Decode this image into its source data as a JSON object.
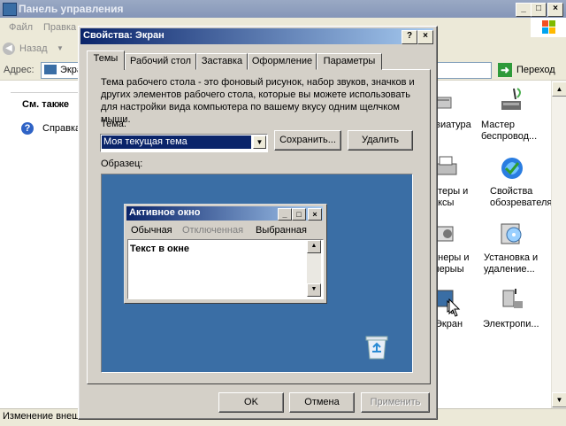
{
  "background_window": {
    "title": "Панель управления",
    "menu": [
      "Файл",
      "Правка"
    ],
    "toolbar": {
      "back_label": "Назад"
    },
    "address": {
      "label": "Адрес:",
      "value": "Экран",
      "go_label": "Переход"
    },
    "see_also": {
      "title": "См. также",
      "items": [
        "Справка"
      ]
    },
    "icons": [
      {
        "name": "keyboard",
        "label": "авиатура"
      },
      {
        "name": "wireless",
        "label": "Мастер\nбеспровод..."
      },
      {
        "name": "printers",
        "label": "нтеры и\nаксы"
      },
      {
        "name": "browser",
        "label": "Свойства\nобозревателя"
      },
      {
        "name": "scanners",
        "label": "анеры и\nмеры"
      },
      {
        "name": "addremove",
        "label": "Установка и\nудаление..."
      },
      {
        "name": "display",
        "label": "Экран"
      },
      {
        "name": "power",
        "label": "Электропи..."
      }
    ],
    "status": "Изменение внешн"
  },
  "dialog": {
    "title": "Свойства: Экран",
    "tabs": [
      "Темы",
      "Рабочий стол",
      "Заставка",
      "Оформление",
      "Параметры"
    ],
    "active_tab": "Темы",
    "description": "Тема рабочего стола - это фоновый рисунок, набор звуков, значков и других элементов рабочего стола, которые вы можете использовать для настройки вида компьютера по вашему вкусу одним щелчком мыши.",
    "theme_label": "Тема:",
    "theme_value": "Моя текущая тема",
    "save_label": "Сохранить...",
    "delete_label": "Удалить",
    "preview_label": "Образец:",
    "preview_window": {
      "title": "Активное окно",
      "menu_normal": "Обычная",
      "menu_disabled": "Отключенная",
      "menu_selected": "Выбранная",
      "text": "Текст в окне"
    },
    "ok_label": "OK",
    "cancel_label": "Отмена",
    "apply_label": "Применить"
  },
  "colors": {
    "desktop_preview": "#3a6ea5",
    "title_active": "#0a246a",
    "face": "#d4d0c8"
  }
}
